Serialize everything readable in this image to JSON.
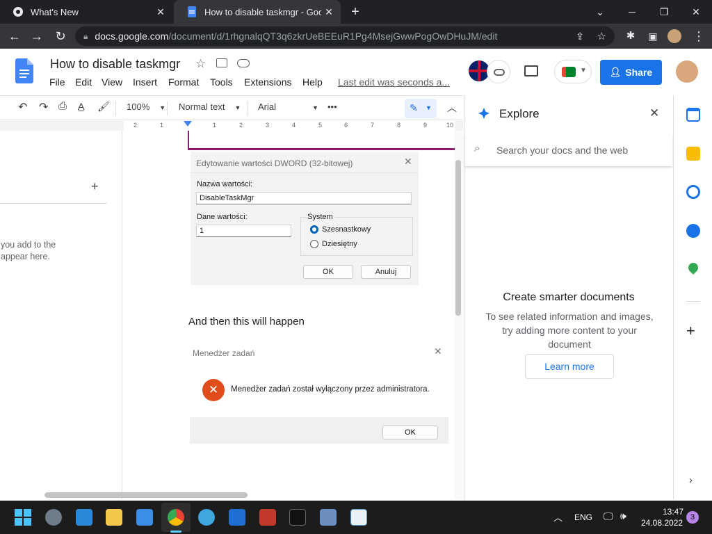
{
  "browser": {
    "tabs": [
      {
        "title": "What's New",
        "active": false
      },
      {
        "title": "How to disable taskmgr - Google",
        "active": true
      }
    ],
    "url_host": "docs.google.com",
    "url_path": "/document/d/1rhgnalqQT3q6zkrUeBEEuR1Pg4MsejGwwPogOwDHuJM/edit"
  },
  "doc": {
    "title": "How to disable taskmgr",
    "menu": [
      "File",
      "Edit",
      "View",
      "Insert",
      "Format",
      "Tools",
      "Extensions",
      "Help"
    ],
    "last_edit": "Last edit was seconds a...",
    "share_label": "Share"
  },
  "toolbar": {
    "zoom": "100%",
    "style": "Normal text",
    "font": "Arial",
    "more": "•••"
  },
  "ruler": [
    "2",
    "1",
    "1",
    "1",
    "2",
    "3",
    "4",
    "5",
    "6",
    "7",
    "8",
    "9",
    "10"
  ],
  "left_pane": {
    "add": "+",
    "hint_line1": "you add to the",
    "hint_line2": "appear here."
  },
  "dialog_dword": {
    "title": "Edytowanie wartości DWORD (32-bitowej)",
    "name_label": "Nazwa wartości:",
    "name_value": "DisableTaskMgr",
    "data_label": "Dane wartości:",
    "data_value": "1",
    "base_label": "System",
    "base_hex": "Szesnastkowy",
    "base_dec": "Dziesiętny",
    "ok": "OK",
    "cancel": "Anuluj"
  },
  "body_text": "And then this will happen",
  "dialog_taskmgr": {
    "title": "Menedżer zadań",
    "message": "Menedżer zadań został wyłączony przez administratora.",
    "ok": "OK"
  },
  "explore": {
    "title": "Explore",
    "search_placeholder": "Search your docs and the web",
    "heading": "Create smarter documents",
    "body": "To see related information and images, try adding more content to your document",
    "learn_more": "Learn more"
  },
  "taskbar": {
    "lang": "ENG",
    "time": "13:47",
    "date": "24.08.2022",
    "notifications": "3"
  },
  "colors": {
    "accent_blue": "#1a73e8",
    "dark_chrome": "#202124",
    "error_red": "#e04c1a"
  }
}
